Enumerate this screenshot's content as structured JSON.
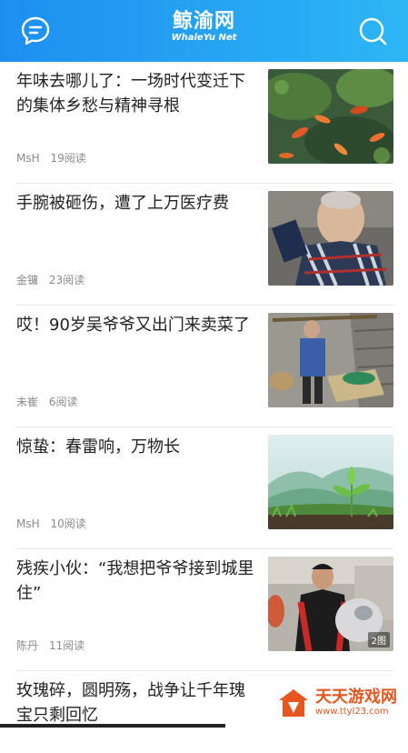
{
  "header": {
    "brand_cn": "鲸渝网",
    "brand_en": "WhaleYu Net",
    "left_icon": "chat-icon",
    "right_icon": "search-icon",
    "color": "#1d8ff0"
  },
  "feed": [
    {
      "title": "年味去哪儿了：一场时代变迁下的集体乡愁与精神寻根",
      "author": "MsH",
      "reads": "19阅读",
      "image": "koi-pond"
    },
    {
      "title": "手腕被砸伤，遭了上万医疗费",
      "author": "金镛",
      "reads": "23阅读",
      "image": "elderly-man"
    },
    {
      "title": "哎！90岁吴爷爷又出门来卖菜了",
      "author": "未崔",
      "reads": "6阅读",
      "image": "vegetable-seller"
    },
    {
      "title": "惊蛰：春雷响，万物长",
      "author": "MsH",
      "reads": "10阅读",
      "image": "sprout-mountains"
    },
    {
      "title": "残疾小伙：“我想把爷爷接到城里住”",
      "author": "陈丹",
      "reads": "11阅读",
      "image": "young-man-scooter",
      "badge": "2图"
    },
    {
      "title": "玫瑰碎，圆明殇，战争让千年瑰宝只剩回忆",
      "author": "",
      "reads": ""
    }
  ],
  "watermark": {
    "cn": "天天游戏网",
    "url": "www.ttyl23.com"
  }
}
